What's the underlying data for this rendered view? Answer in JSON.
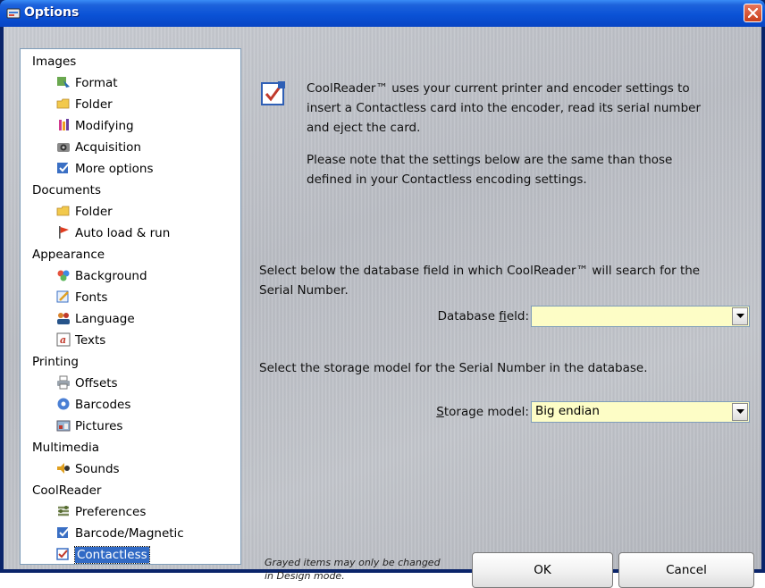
{
  "window": {
    "title": "Options",
    "close_label": "×"
  },
  "tree": {
    "categories": [
      {
        "label": "Images",
        "items": [
          {
            "label": "Format",
            "icon": "format-icon"
          },
          {
            "label": "Folder",
            "icon": "folder-icon"
          },
          {
            "label": "Modifying",
            "icon": "modifying-icon"
          },
          {
            "label": "Acquisition",
            "icon": "camera-icon"
          },
          {
            "label": "More options",
            "icon": "more-options-icon"
          }
        ]
      },
      {
        "label": "Documents",
        "items": [
          {
            "label": "Folder",
            "icon": "folder-icon"
          },
          {
            "label": "Auto load & run",
            "icon": "flag-icon"
          }
        ]
      },
      {
        "label": "Appearance",
        "items": [
          {
            "label": "Background",
            "icon": "background-icon"
          },
          {
            "label": "Fonts",
            "icon": "fonts-icon"
          },
          {
            "label": "Language",
            "icon": "language-icon"
          },
          {
            "label": "Texts",
            "icon": "texts-icon"
          }
        ]
      },
      {
        "label": "Printing",
        "items": [
          {
            "label": "Offsets",
            "icon": "printer-icon"
          },
          {
            "label": "Barcodes",
            "icon": "barcodes-icon"
          },
          {
            "label": "Pictures",
            "icon": "pictures-icon"
          }
        ]
      },
      {
        "label": "Multimedia",
        "items": [
          {
            "label": "Sounds",
            "icon": "sounds-icon"
          }
        ]
      },
      {
        "label": "CoolReader",
        "items": [
          {
            "label": "Preferences",
            "icon": "preferences-icon"
          },
          {
            "label": "Barcode/Magnetic",
            "icon": "barcode-magnetic-icon"
          },
          {
            "label": "Contactless",
            "icon": "contactless-icon",
            "selected": true
          }
        ]
      }
    ]
  },
  "panel": {
    "intro_lines": [
      "CoolReader™ uses your current printer and encoder settings to",
      "insert a Contactless card into the encoder, read its serial number",
      "and eject the card."
    ],
    "note_lines": [
      "Please note that the settings below are the same than those",
      "defined in your Contactless encoding settings."
    ],
    "db_instruction_lines": [
      "Select below the database field in which CoolReader™ will search for the",
      "Serial Number."
    ],
    "database_field": {
      "label_pre": "Database ",
      "label_ul": "f",
      "label_post": "ield:",
      "value": ""
    },
    "storage_instruction": "Select the storage model for the Serial Number in the database.",
    "storage_model": {
      "label_ul": "S",
      "label_post": "torage model:",
      "value": "Big endian"
    },
    "footnote_lines": [
      "Grayed items may only be changed",
      "in Design mode."
    ]
  },
  "buttons": {
    "ok": "OK",
    "cancel": "Cancel"
  },
  "colors": {
    "title_bar": "#0a52d6",
    "combo_bg": "#fdfdc6",
    "selection": "#316ac5",
    "close": "#c8401c"
  }
}
